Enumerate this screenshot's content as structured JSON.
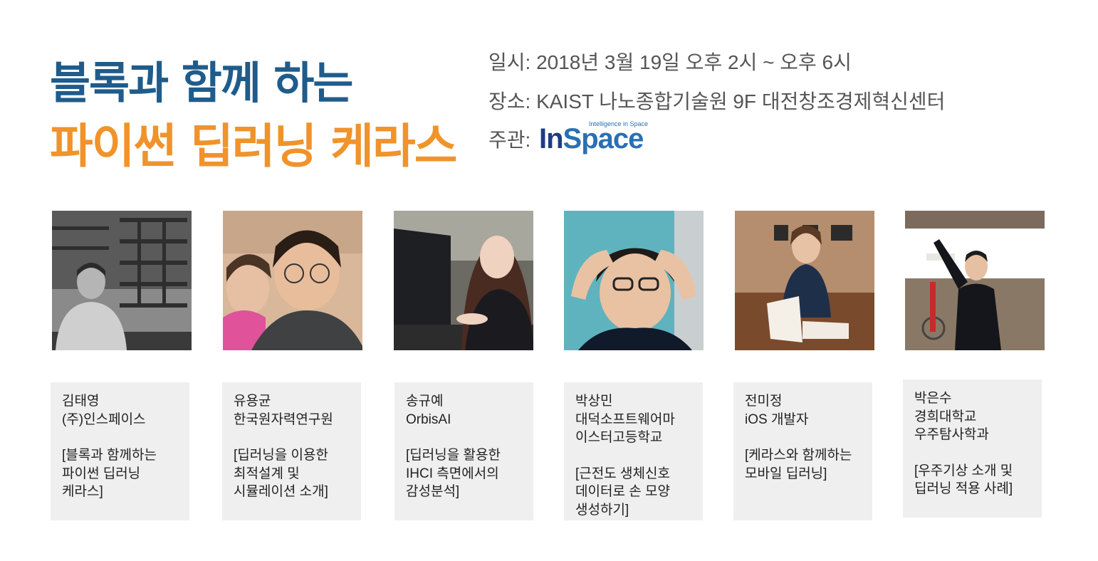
{
  "header": {
    "title_line1": "블록과 함께 하는",
    "title_line2": "파이썬 딥러닝 케라스",
    "date": "일시: 2018년 3월 19일 오후 2시 ~ 오후 6시",
    "place": "장소: KAIST 나노종합기술원 9F 대전창조경제혁신센터",
    "host_label": "주관:",
    "logo_text_in": "In",
    "logo_text_space": "Space",
    "logo_tagline": "Intelligence in Space"
  },
  "speakers": [
    {
      "name": "김태영",
      "affil": [
        "(주)인스페이스"
      ],
      "talk": [
        "[블록과 함께하는",
        "파이썬 딥러닝",
        "케라스]"
      ]
    },
    {
      "name": "유용균",
      "affil": [
        "한국원자력연구원"
      ],
      "talk": [
        "[딥러닝을 이용한",
        "최적설계 및",
        "시뮬레이션 소개]"
      ]
    },
    {
      "name": "송규예",
      "affil": [
        "OrbisAI"
      ],
      "talk": [
        "[딥러닝을 활용한",
        "IHCI 측면에서의",
        "감성분석]"
      ]
    },
    {
      "name": "박상민",
      "affil": [
        "대덕소프트웨어마",
        "이스터고등학교"
      ],
      "talk": [
        "[근전도 생체신호",
        "데이터로 손 모양",
        "생성하기]"
      ]
    },
    {
      "name": "전미정",
      "affil": [
        "iOS 개발자"
      ],
      "talk": [
        "[케라스와 함께하는",
        "모바일 딥러닝]"
      ]
    },
    {
      "name": "박은수",
      "affil": [
        "경희대학교",
        "우주탐사학과"
      ],
      "talk": [
        "[우주기상 소개 및",
        "딥러닝 적용 사례]"
      ]
    }
  ],
  "colors": {
    "title_blue": "#1f5c8b",
    "title_orange": "#f0932b",
    "card_bg": "#efefef"
  }
}
